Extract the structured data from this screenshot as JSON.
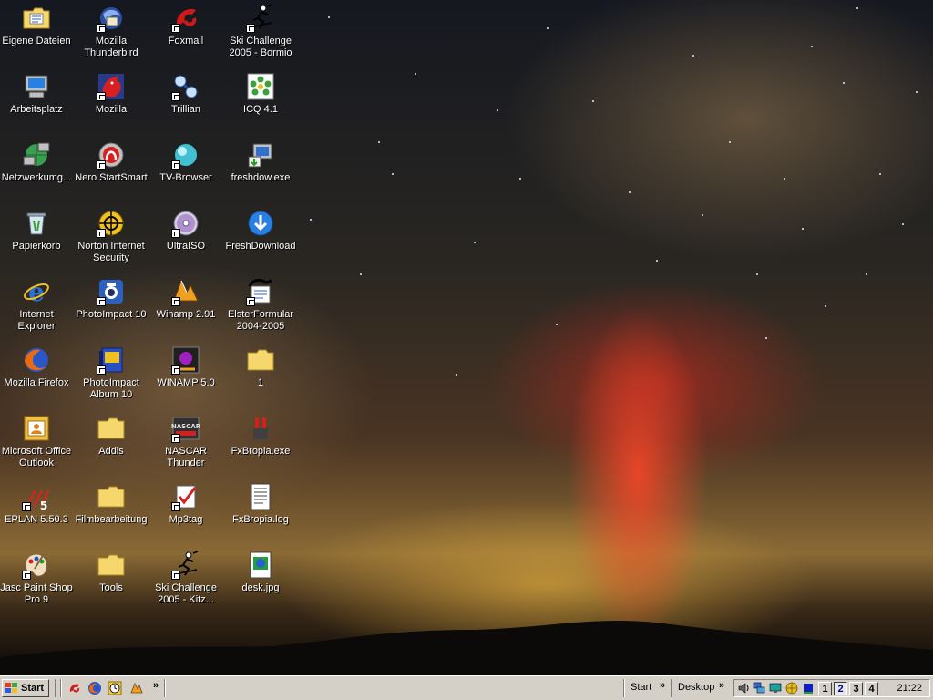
{
  "desktop": {
    "icons": [
      {
        "label": "Eigene Dateien",
        "icon": "folder-documents-icon"
      },
      {
        "label": "Mozilla Thunderbird",
        "icon": "thunderbird-icon"
      },
      {
        "label": "Foxmail",
        "icon": "foxmail-icon"
      },
      {
        "label": "Ski Challenge 2005 - Bormio",
        "icon": "skier-icon"
      },
      {
        "label": "Arbeitsplatz",
        "icon": "computer-icon"
      },
      {
        "label": "Mozilla",
        "icon": "mozilla-icon"
      },
      {
        "label": "Trillian",
        "icon": "trillian-icon"
      },
      {
        "label": "ICQ 4.1",
        "icon": "icq-icon"
      },
      {
        "label": "Netzwerkumg...",
        "icon": "network-icon"
      },
      {
        "label": "Nero StartSmart",
        "icon": "nero-icon"
      },
      {
        "label": "TV-Browser",
        "icon": "tv-browser-icon"
      },
      {
        "label": "freshdow.exe",
        "icon": "installer-icon"
      },
      {
        "label": "Papierkorb",
        "icon": "recycle-bin-icon"
      },
      {
        "label": "Norton Internet Security",
        "icon": "norton-icon"
      },
      {
        "label": "UltraISO",
        "icon": "disc-icon"
      },
      {
        "label": "FreshDownload",
        "icon": "download-icon"
      },
      {
        "label": "Internet Explorer",
        "icon": "ie-icon"
      },
      {
        "label": "PhotoImpact 10",
        "icon": "camera-icon"
      },
      {
        "label": "Winamp 2.91",
        "icon": "winamp-icon"
      },
      {
        "label": "ElsterFormular 2004-2005",
        "icon": "elster-icon"
      },
      {
        "label": "Mozilla Firefox",
        "icon": "firefox-icon"
      },
      {
        "label": "PhotoImpact Album 10",
        "icon": "album-icon"
      },
      {
        "label": "WINAMP 5.0",
        "icon": "winamp5-icon"
      },
      {
        "label": "1",
        "icon": "folder-icon"
      },
      {
        "label": "Microsoft Office Outlook",
        "icon": "outlook-icon"
      },
      {
        "label": "Addis",
        "icon": "folder-icon"
      },
      {
        "label": "NASCAR Thunder",
        "icon": "nascar-icon"
      },
      {
        "label": "FxBropia.exe",
        "icon": "exe-icon"
      },
      {
        "label": "EPLAN 5.50.3",
        "icon": "eplan-icon"
      },
      {
        "label": "Filmbearbeitung",
        "icon": "folder-icon"
      },
      {
        "label": "Mp3tag",
        "icon": "mp3tag-icon"
      },
      {
        "label": "FxBropia.log",
        "icon": "text-file-icon"
      },
      {
        "label": "Jasc Paint Shop Pro 9",
        "icon": "palette-icon"
      },
      {
        "label": "Tools",
        "icon": "folder-icon"
      },
      {
        "label": "Ski Challenge 2005 - Kitz...",
        "icon": "skier-icon"
      },
      {
        "label": "desk.jpg",
        "icon": "image-file-icon"
      }
    ]
  },
  "taskbar": {
    "start_label": "Start",
    "quicklaunch": [
      "foxmail-icon",
      "firefox-icon",
      "clock-icon",
      "winamp-icon"
    ],
    "chevron": "»",
    "toolbar_start_label": "Start",
    "toolbar_desktop_label": "Desktop",
    "tray_icons": [
      "speaker-icon",
      "network-icon",
      "monitor-icon",
      "globe-icon",
      "display-icon"
    ],
    "virtual_desktops": [
      "1",
      "2",
      "3",
      "4"
    ],
    "active_desktop": "2",
    "clock": "21:22"
  },
  "colors": {
    "taskbar": "#d4d0c8",
    "label_text": "#ffffff",
    "folder_yellow": "#f5d76e"
  }
}
